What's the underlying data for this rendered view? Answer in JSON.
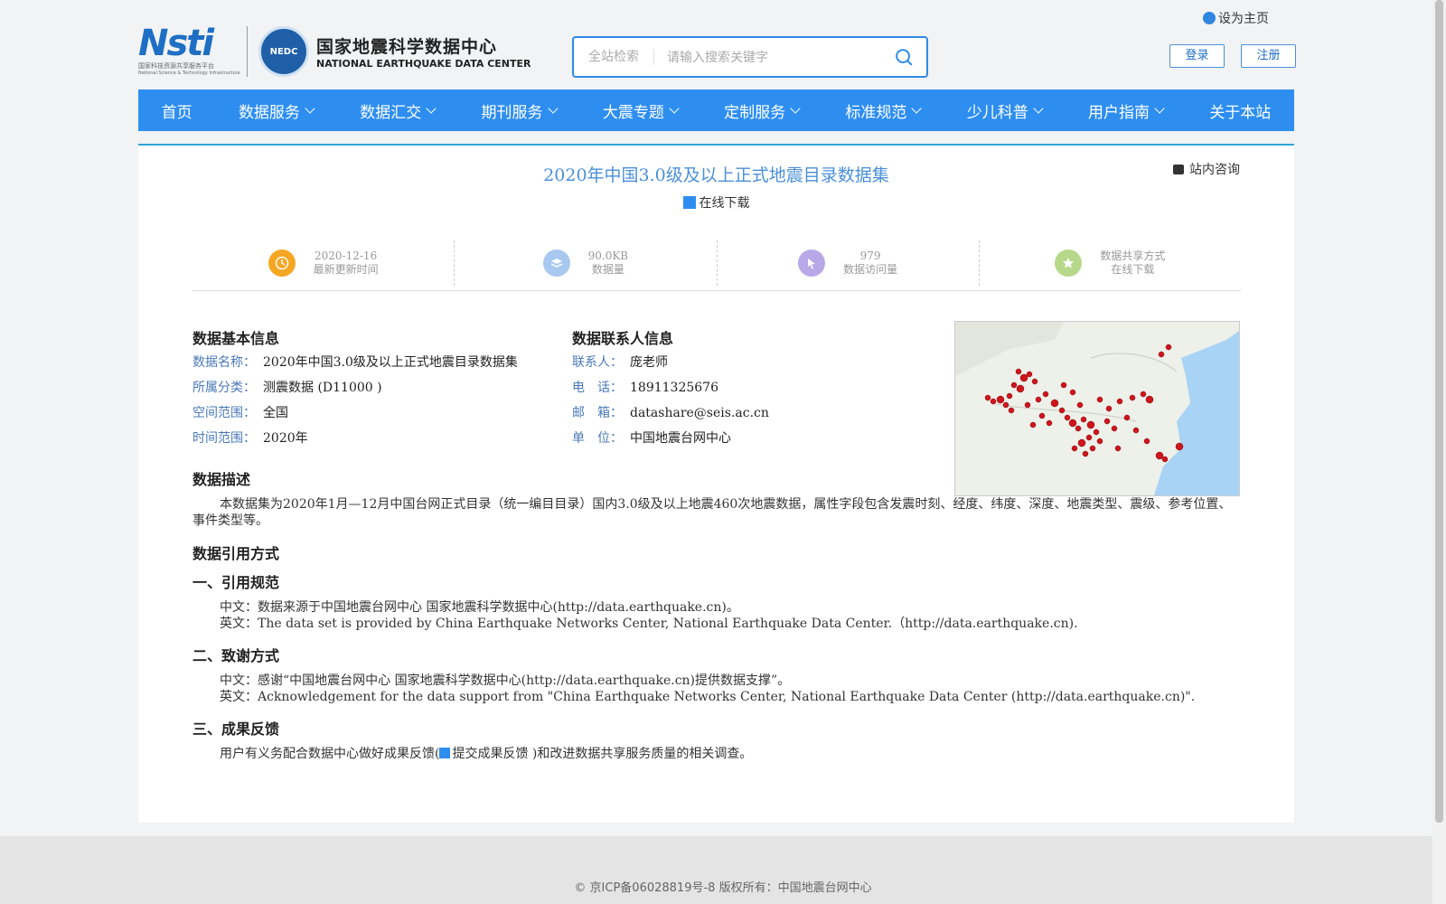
{
  "header": {
    "set_homepage": "设为主页",
    "nsti_logo": "Nsti",
    "nsti_caption": "国家科技资源共享服务平台",
    "nsti_caption_en": "National Science & Technology Infrastructure",
    "seal_text": "NEDC",
    "center_name_cn": "国家地震科学数据中心",
    "center_name_en": "NATIONAL EARTHQUAKE DATA CENTER",
    "search_scope": "全站检索",
    "search_placeholder": "请输入搜索关键字",
    "login": "登录",
    "register": "注册"
  },
  "nav": [
    {
      "label": "首页",
      "dropdown": false
    },
    {
      "label": "数据服务",
      "dropdown": true
    },
    {
      "label": "数据汇交",
      "dropdown": true
    },
    {
      "label": "期刊服务",
      "dropdown": true
    },
    {
      "label": "大震专题",
      "dropdown": true
    },
    {
      "label": "定制服务",
      "dropdown": true
    },
    {
      "label": "标准规范",
      "dropdown": true
    },
    {
      "label": "少儿科普",
      "dropdown": true
    },
    {
      "label": "用户指南",
      "dropdown": true
    },
    {
      "label": "关于本站",
      "dropdown": false
    }
  ],
  "dataset": {
    "title": "2020年中国3.0级及以上正式地震目录数据集",
    "consult": "站内咨询",
    "download": "在线下载"
  },
  "stats": [
    {
      "value": "2020-12-16",
      "label": "最新更新时间",
      "icon": "clock-icon",
      "color": "#f5a623"
    },
    {
      "value": "90.0KB",
      "label": "数据量",
      "icon": "layers-icon",
      "color": "#a8c8f0"
    },
    {
      "value": "979",
      "label": "数据访问量",
      "icon": "cursor-icon",
      "color": "#b9a8e8"
    },
    {
      "value": "数据共享方式",
      "label": "在线下载",
      "icon": "star-icon",
      "color": "#b7d88a"
    }
  ],
  "basic_info": {
    "heading": "数据基本信息",
    "rows": [
      {
        "key": "数据名称：",
        "value": "2020年中国3.0级及以上正式地震目录数据集"
      },
      {
        "key": "所属分类：",
        "value": "测震数据 (D11000 )"
      },
      {
        "key": "空间范围：",
        "value": "全国"
      },
      {
        "key": "时间范围：",
        "value": "2020年"
      }
    ]
  },
  "contact_info": {
    "heading": "数据联系人信息",
    "rows": [
      {
        "key": "联系人：",
        "value": "庞老师"
      },
      {
        "key": "电　话：",
        "value": "18911325676"
      },
      {
        "key": "邮　箱：",
        "value": "datashare@seis.ac.cn"
      },
      {
        "key": "单　位：",
        "value": "中国地震台网中心"
      }
    ]
  },
  "description": {
    "heading": "数据描述",
    "text": "本数据集为2020年1月—12月中国台网正式目录（统一编目目录）国内3.0级及以上地震460次地震数据，属性字段包含发震时刻、经度、纬度、深度、地震类型、震级、参考位置、事件类型等。"
  },
  "citation": {
    "heading": "数据引用方式",
    "spec_heading": "一、引用规范",
    "spec_cn": "中文：数据来源于中国地震台网中心 国家地震科学数据中心(http://data.earthquake.cn)。",
    "spec_en": "英文：The data set is provided by China Earthquake Networks Center, National Earthquake Data Center.（http://data.earthquake.cn).",
    "ack_heading": "二、致谢方式",
    "ack_cn": "中文：感谢“中国地震台网中心 国家地震科学数据中心(http://data.earthquake.cn)提供数据支撑”。",
    "ack_en": "英文：Acknowledgement for the data support from \"China Earthquake Networks Center, National Earthquake Data Center (http://data.earthquake.cn)\".",
    "feedback_heading": "三、成果反馈",
    "feedback_pre": "用户有义务配合数据中心做好成果反馈(",
    "feedback_link": "提交成果反馈",
    "feedback_post": " )和改进数据共享服务质量的相关调查。"
  },
  "footer": {
    "copyright": "© 京ICP备06028819号-8 版权所有：中国地震台网中心"
  }
}
